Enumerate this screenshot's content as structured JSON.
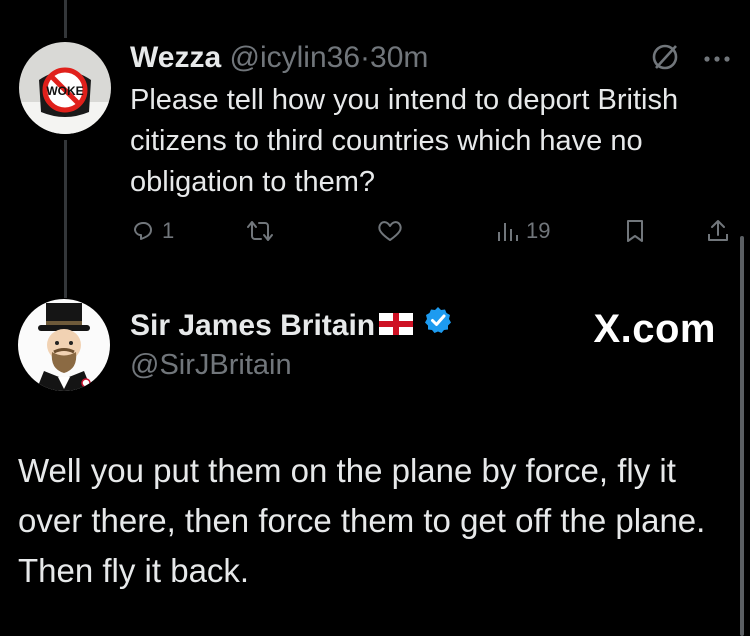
{
  "reply": {
    "display_name": "Wezza",
    "handle": "@icylin36",
    "separator": "·",
    "time": "30m",
    "avatar_text": "WOKE",
    "text": "Please tell how you intend to deport British citizens to third countries which have no obligation to them?",
    "reply_count": "1",
    "views_count": "19",
    "icons": [
      "grok-slash-icon",
      "more-icon",
      "reply-icon",
      "retweet-icon",
      "like-icon",
      "views-icon",
      "bookmark-icon",
      "share-icon"
    ]
  },
  "author": {
    "display_name": "Sir James Britain",
    "handle": "@SirJBritain",
    "flag": "england-flag",
    "verified": true,
    "verified_color": "#1d9bf0"
  },
  "brand": "X.com",
  "post_text": "Well you put them on the plane by force, fly it over there, then force them to get off the plane. Then fly it back.",
  "colors": {
    "background": "#000000",
    "text": "#e7e9ea",
    "muted": "#71767b"
  }
}
